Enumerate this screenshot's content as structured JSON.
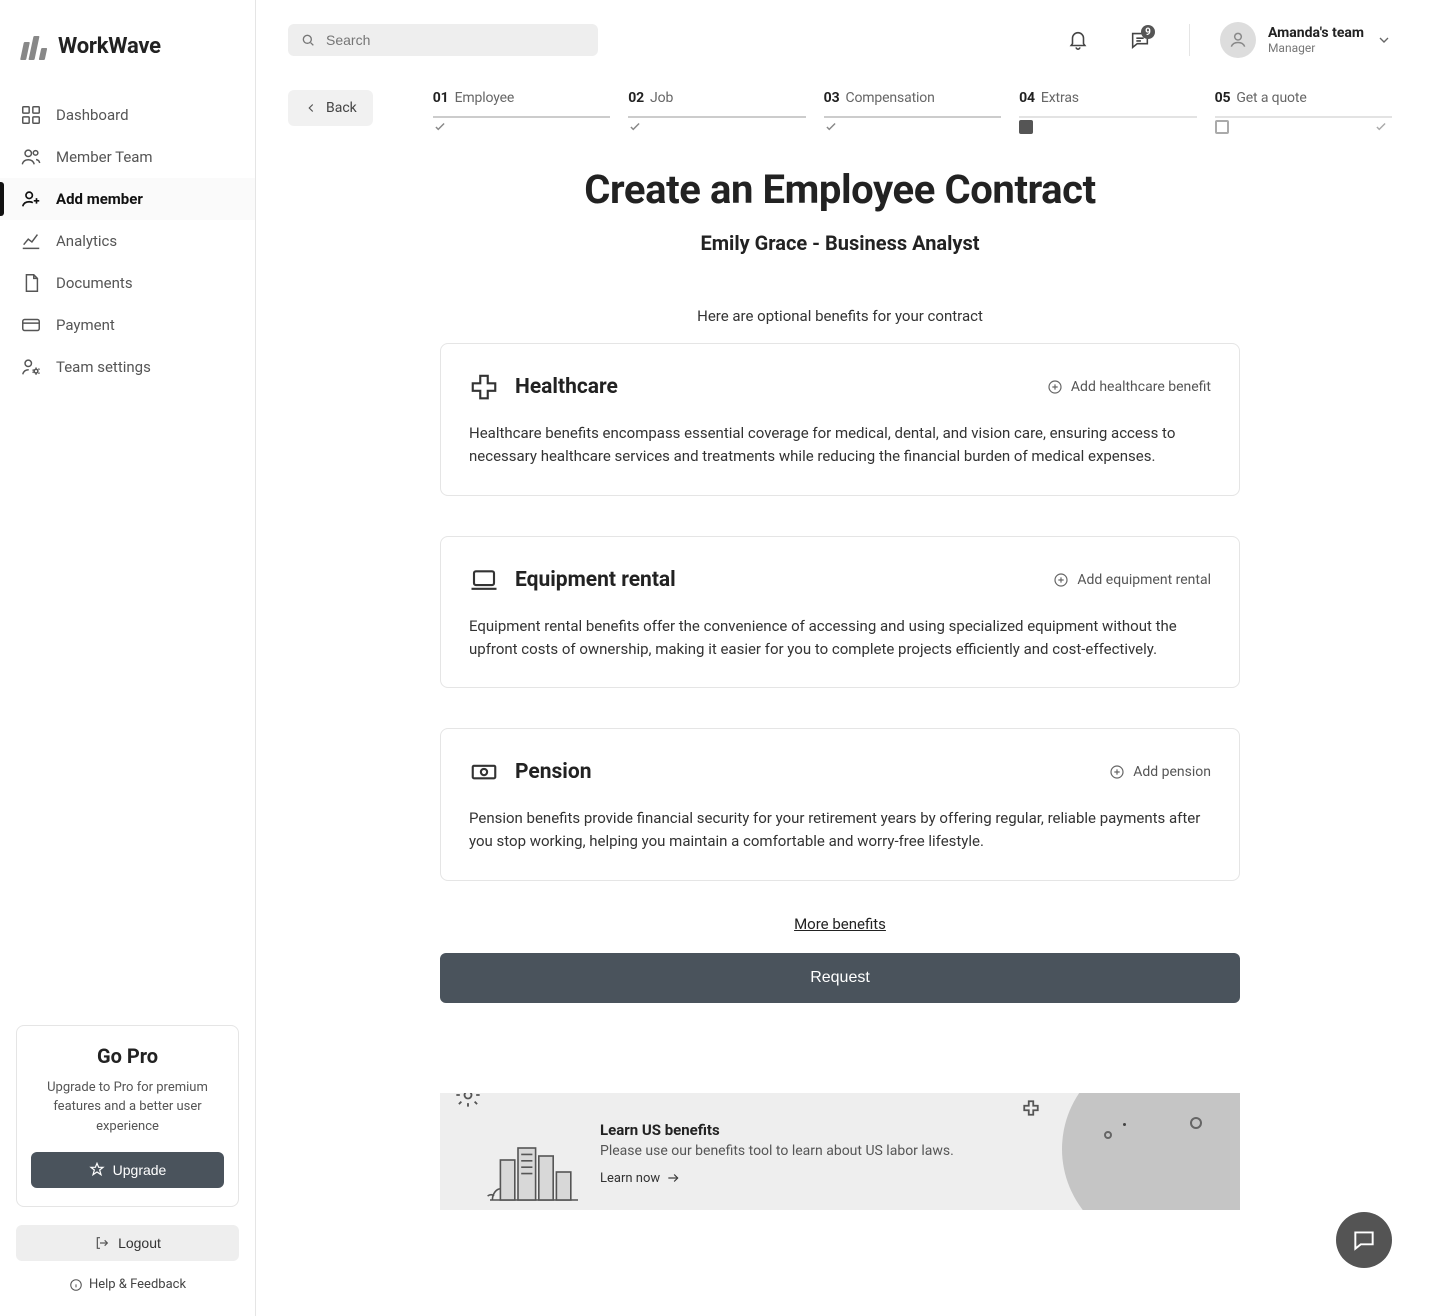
{
  "brand": {
    "name": "WorkWave"
  },
  "sidebar": {
    "items": [
      {
        "key": "dashboard",
        "label": "Dashboard"
      },
      {
        "key": "member-team",
        "label": "Member Team"
      },
      {
        "key": "add-member",
        "label": "Add member"
      },
      {
        "key": "analytics",
        "label": "Analytics"
      },
      {
        "key": "documents",
        "label": "Documents"
      },
      {
        "key": "payment",
        "label": "Payment"
      },
      {
        "key": "team-settings",
        "label": "Team settings"
      }
    ],
    "active_key": "add-member"
  },
  "promo": {
    "title": "Go Pro",
    "desc": "Upgrade to Pro for premium features and a better user experience",
    "cta": "Upgrade"
  },
  "logout_label": "Logout",
  "help_label": "Help & Feedback",
  "search": {
    "placeholder": "Search"
  },
  "topbar": {
    "messages_badge": "9",
    "team_name": "Amanda's team",
    "team_role": "Manager"
  },
  "back_label": "Back",
  "steps": [
    {
      "num": "01",
      "label": "Employee",
      "state": "done"
    },
    {
      "num": "02",
      "label": "Job",
      "state": "done"
    },
    {
      "num": "03",
      "label": "Compensation",
      "state": "done"
    },
    {
      "num": "04",
      "label": "Extras",
      "state": "current"
    },
    {
      "num": "05",
      "label": "Get a quote",
      "state": "pending"
    }
  ],
  "page": {
    "title": "Create an Employee Contract",
    "subtitle": "Emily Grace - Business Analyst",
    "intro": "Here are optional benefits for your contract"
  },
  "benefits": [
    {
      "key": "healthcare",
      "title": "Healthcare",
      "cta": "Add healthcare benefit",
      "desc": "Healthcare benefits encompass essential coverage for medical, dental, and vision care, ensuring access to necessary healthcare services and treatments while reducing the financial burden of medical expenses."
    },
    {
      "key": "equipment",
      "title": "Equipment rental",
      "cta": "Add equipment rental",
      "desc": "Equipment rental benefits offer the convenience of accessing and using specialized equipment without the upfront costs of ownership, making it easier for you to complete projects efficiently and cost-effectively."
    },
    {
      "key": "pension",
      "title": "Pension",
      "cta": "Add pension",
      "desc": "Pension benefits provide financial security for your retirement years by offering regular, reliable payments after you stop working, helping you maintain a comfortable and worry-free lifestyle."
    }
  ],
  "more_benefits_label": "More benefits",
  "request_label": "Request",
  "learn": {
    "title": "Learn US benefits",
    "desc": "Please use our benefits tool to learn about US labor laws.",
    "cta": "Learn now"
  }
}
